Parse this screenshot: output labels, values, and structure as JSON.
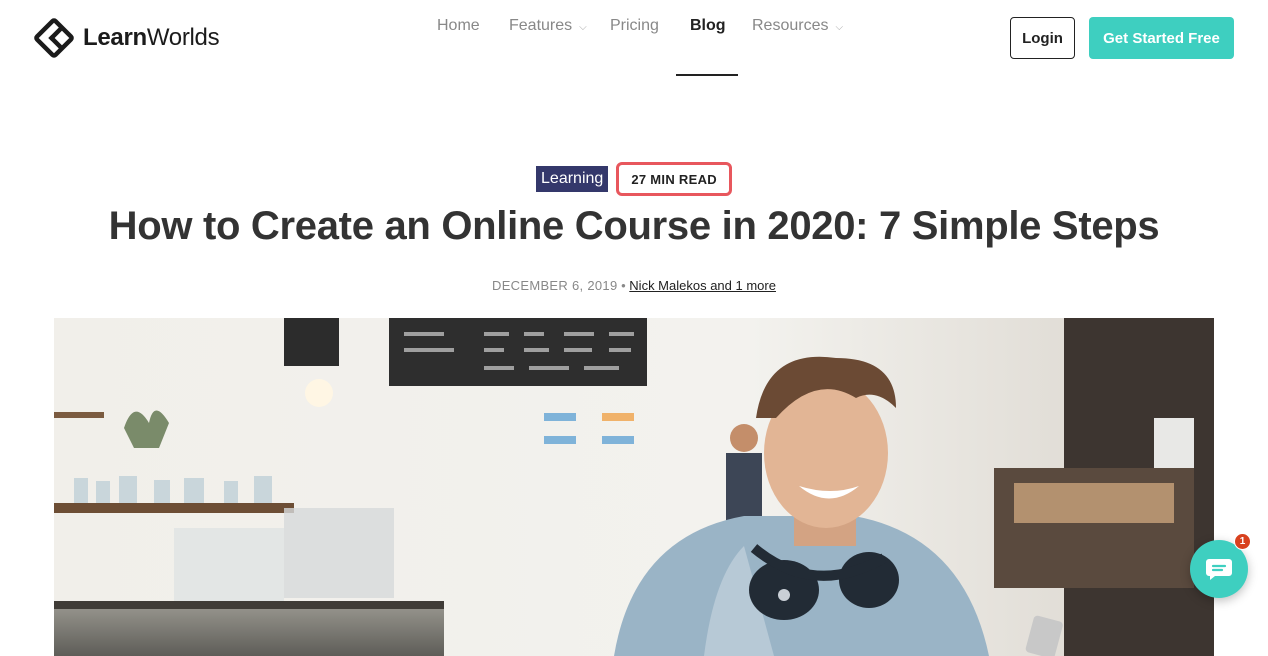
{
  "brand": {
    "name_bold": "Learn",
    "name_light": "Worlds"
  },
  "nav": {
    "home": "Home",
    "features": "Features",
    "pricing": "Pricing",
    "blog": "Blog",
    "resources": "Resources"
  },
  "actions": {
    "login": "Login",
    "get_started": "Get Started Free"
  },
  "article": {
    "category": "Learning",
    "read_time": "27 MIN READ",
    "title": "How to Create an Online Course in 2020: 7 Simple Steps",
    "date": "DECEMBER 6, 2019",
    "separator": "•",
    "authors": "Nick Malekos and 1 more"
  },
  "chat": {
    "badge_count": "1"
  },
  "colors": {
    "accent": "#3ecfc0",
    "category_bg": "#34386b",
    "highlight": "#e8575d",
    "badge": "#d8411e"
  }
}
